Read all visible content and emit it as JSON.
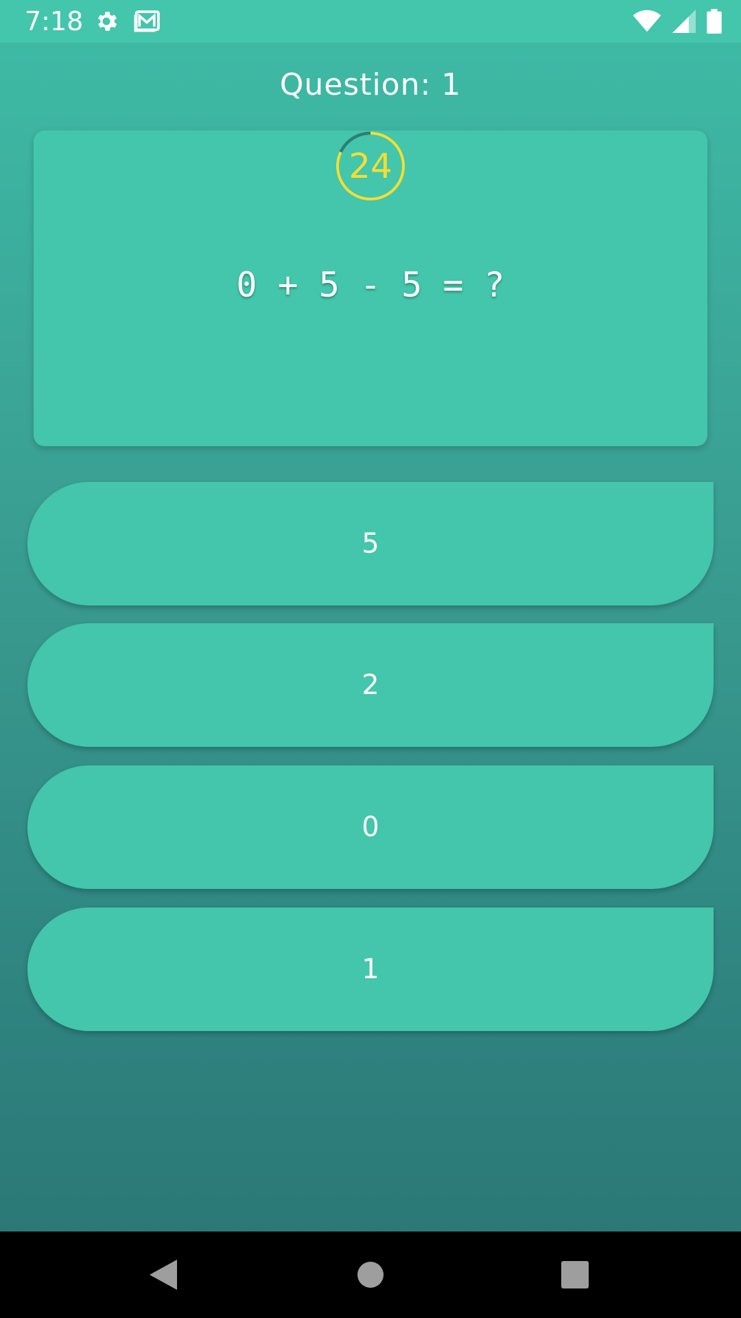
{
  "status_bar": {
    "time": "7:18",
    "icons_left": [
      "gear-icon",
      "mail-icon"
    ],
    "icons_right": [
      "wifi-icon",
      "signal-icon",
      "battery-icon"
    ]
  },
  "header": {
    "title": "Question: 1"
  },
  "question_card": {
    "timer_value": "24",
    "timer_color": "#f4dd35",
    "question": "0 + 5 - 5 = ?"
  },
  "answers": [
    {
      "label": "5"
    },
    {
      "label": "2"
    },
    {
      "label": "0"
    },
    {
      "label": "1"
    }
  ],
  "colors": {
    "accent": "#43c6ab",
    "text": "#ffffff"
  },
  "nav_bar": {
    "icons": [
      "back-icon",
      "home-icon",
      "recents-icon"
    ]
  }
}
